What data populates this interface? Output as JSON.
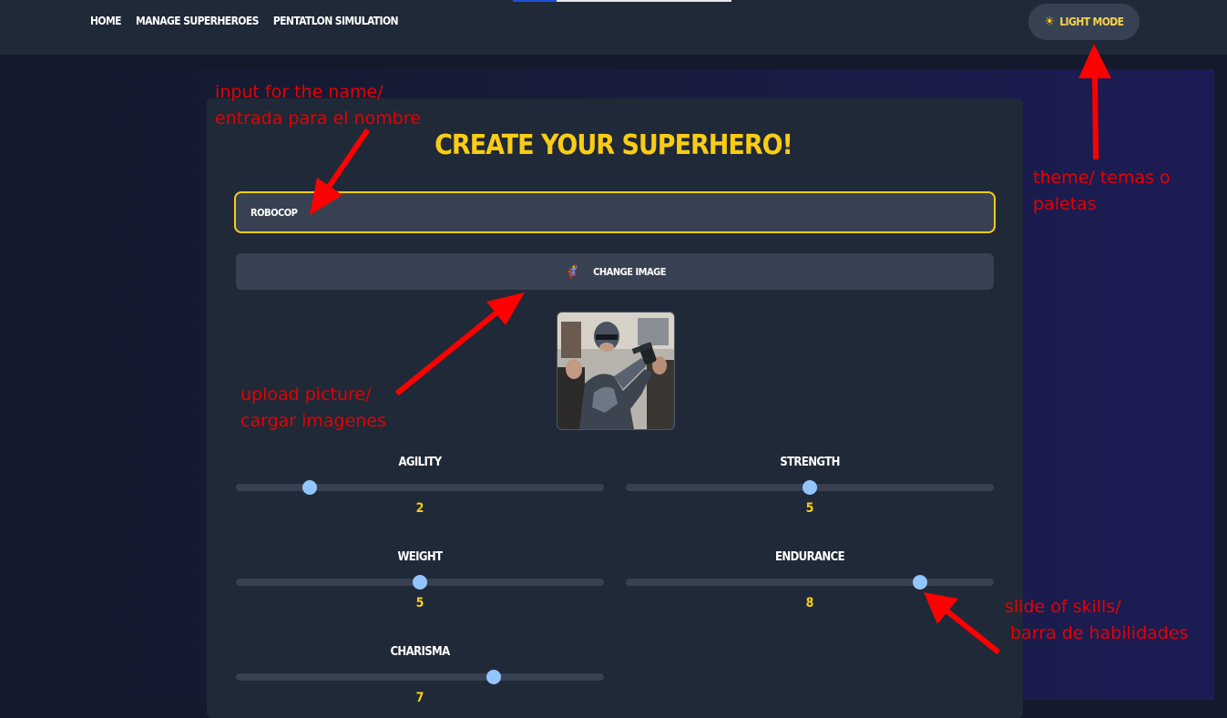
{
  "nav": {
    "links": [
      "HOME",
      "MANAGE SUPERHEROES",
      "PENTATLON SIMULATION"
    ],
    "theme_icon": "sun-icon",
    "theme_label": "LIGHT MODE"
  },
  "form": {
    "title": "CREATE YOUR SUPERHERO!",
    "name_value": "ROBOCOP",
    "change_image_icon": "superhero-icon",
    "change_image_label": "CHANGE IMAGE",
    "image_alt": "RoboCop"
  },
  "skills": [
    {
      "label": "AGILITY",
      "value": 2,
      "fraction": 0.2
    },
    {
      "label": "STRENGTH",
      "value": 5,
      "fraction": 0.5
    },
    {
      "label": "WEIGHT",
      "value": 5,
      "fraction": 0.5
    },
    {
      "label": "ENDURANCE",
      "value": 8,
      "fraction": 0.8
    },
    {
      "label": "CHARISMA",
      "value": 7,
      "fraction": 0.7
    }
  ],
  "annotations": {
    "name": "input for the name/\nentrada para el nombre",
    "theme": "theme/ temas o\npaletas",
    "upload": "upload picture/\ncargar imagenes",
    "slider": "slide of skills/\n barra de habilidades"
  },
  "colors": {
    "accent": "#facc15",
    "annotation": "#e60000",
    "slider_thumb": "#93c5fd",
    "background": "#1f2937"
  }
}
